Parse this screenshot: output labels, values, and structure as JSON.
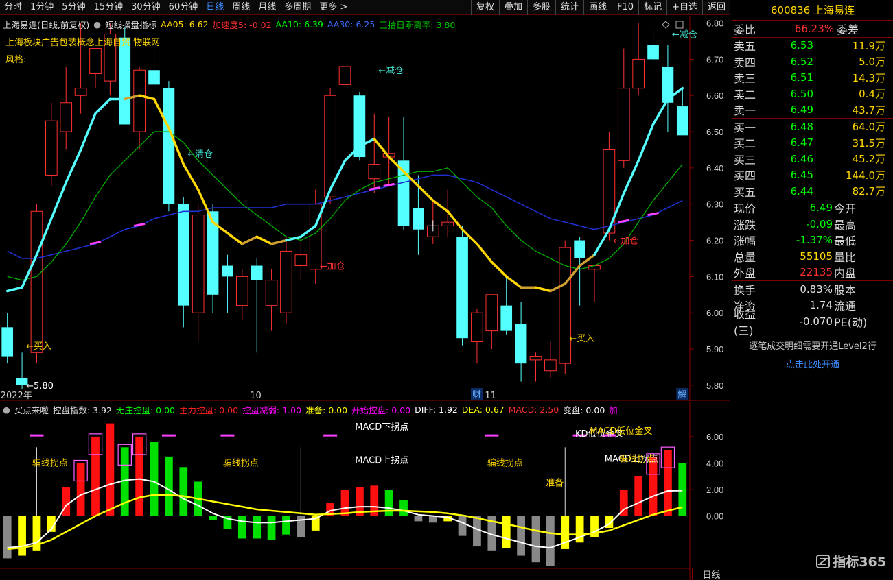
{
  "toolbar": {
    "periods": [
      "分时",
      "1分钟",
      "5分钟",
      "15分钟",
      "30分钟",
      "60分钟",
      "日线",
      "周线",
      "月线",
      "多周期",
      "更多 >"
    ],
    "active": "日线",
    "buttons": [
      "复权",
      "叠加",
      "多股",
      "统计",
      "画线",
      "F10",
      "标记",
      "+自选",
      "返回"
    ]
  },
  "main_indicator": {
    "stock_title": "上海易连(日线,前复权)",
    "name": "短线操盘指标",
    "items": [
      {
        "label": "AA05:",
        "value": "6.62",
        "color": "#ffd700"
      },
      {
        "label": "加速度5:",
        "value": "-0.02",
        "color": "#ff3030"
      },
      {
        "label": "AA10:",
        "value": "6.39",
        "color": "#00ff00"
      },
      {
        "label": "AA30:",
        "value": "6.25",
        "color": "#3d6bff"
      },
      {
        "label": "三拾日乖离率:",
        "value": "3.80",
        "color": "#00c800"
      }
    ],
    "sector_line": "上海板块广告包装概念上海自贸 物联网",
    "style_line": "风格:"
  },
  "sub_indicator": {
    "name": "买点来啦",
    "items": [
      {
        "label": "控盘指数:",
        "value": "3.92",
        "color": "#e0e0e0"
      },
      {
        "label": "无庄控盘:",
        "value": "0.00",
        "color": "#00ff00"
      },
      {
        "label": "主力控盘:",
        "value": "0.00",
        "color": "#ff2020"
      },
      {
        "label": "控盘减弱:",
        "value": "1.00",
        "color": "#ff00ff"
      },
      {
        "label": "准备:",
        "value": "0.00",
        "color": "#ffff00"
      },
      {
        "label": "开始控盘:",
        "value": "0.00",
        "color": "#ff00ff"
      },
      {
        "label": "DIFF:",
        "value": "1.92",
        "color": "#ffffff"
      },
      {
        "label": "DEA:",
        "value": "0.67",
        "color": "#ffff00"
      },
      {
        "label": "MACD:",
        "value": "2.50",
        "color": "#ff3030"
      },
      {
        "label": "变盘:",
        "value": "0.00",
        "color": "#ffffff"
      },
      {
        "label": "加",
        "value": "",
        "color": "#ff00ff"
      }
    ]
  },
  "chart_data": {
    "type": "candlestick",
    "ylim": [
      5.76,
      6.82
    ],
    "y_ticks": [
      "6.80",
      "6.70",
      "6.60",
      "6.50",
      "6.40",
      "6.30",
      "6.20",
      "6.10",
      "6.00",
      "5.90",
      "5.80"
    ],
    "x_labels": [
      {
        "i": 0,
        "text": "2022年"
      },
      {
        "i": 17,
        "text": "10"
      },
      {
        "i": 33,
        "text": "11"
      }
    ],
    "markers": [
      {
        "i": 32,
        "text": "财"
      },
      {
        "i": 46,
        "text": "解"
      }
    ],
    "candles": [
      {
        "o": 5.96,
        "h": 6.0,
        "l": 5.86,
        "c": 5.88
      },
      {
        "o": 5.82,
        "h": 5.89,
        "l": 5.79,
        "c": 5.8
      },
      {
        "o": 5.89,
        "h": 6.3,
        "l": 5.86,
        "c": 6.28
      },
      {
        "o": 6.38,
        "h": 6.58,
        "l": 6.35,
        "c": 6.53
      },
      {
        "o": 6.5,
        "h": 6.68,
        "l": 6.45,
        "c": 6.58
      },
      {
        "o": 6.6,
        "h": 6.8,
        "l": 6.55,
        "c": 6.62
      },
      {
        "o": 6.66,
        "h": 6.72,
        "l": 6.62,
        "c": 6.73
      },
      {
        "o": 6.64,
        "h": 6.8,
        "l": 6.6,
        "c": 6.77
      },
      {
        "o": 6.76,
        "h": 6.79,
        "l": 6.6,
        "c": 6.52
      },
      {
        "o": 6.5,
        "h": 6.68,
        "l": 6.45,
        "c": 6.67
      },
      {
        "o": 6.67,
        "h": 6.74,
        "l": 6.58,
        "c": 6.63
      },
      {
        "o": 6.62,
        "h": 6.64,
        "l": 6.28,
        "c": 6.3
      },
      {
        "o": 6.3,
        "h": 6.32,
        "l": 5.96,
        "c": 6.02
      },
      {
        "o": 6.0,
        "h": 6.3,
        "l": 5.92,
        "c": 6.27
      },
      {
        "o": 6.28,
        "h": 6.3,
        "l": 6.0,
        "c": 6.05
      },
      {
        "o": 6.13,
        "h": 6.16,
        "l": 6.0,
        "c": 6.1
      },
      {
        "o": 6.02,
        "h": 6.12,
        "l": 5.98,
        "c": 6.1
      },
      {
        "o": 6.13,
        "h": 6.15,
        "l": 5.89,
        "c": 6.09
      },
      {
        "o": 6.02,
        "h": 6.12,
        "l": 5.95,
        "c": 6.09
      },
      {
        "o": 6.0,
        "h": 6.21,
        "l": 5.97,
        "c": 6.17
      },
      {
        "o": 6.13,
        "h": 6.2,
        "l": 6.09,
        "c": 6.16
      },
      {
        "o": 6.12,
        "h": 6.34,
        "l": 6.08,
        "c": 6.3
      },
      {
        "o": 6.32,
        "h": 6.62,
        "l": 6.3,
        "c": 6.6
      },
      {
        "o": 6.63,
        "h": 6.72,
        "l": 6.55,
        "c": 6.68
      },
      {
        "o": 6.6,
        "h": 6.61,
        "l": 6.42,
        "c": 6.43
      },
      {
        "o": 6.37,
        "h": 6.55,
        "l": 6.33,
        "c": 6.41
      },
      {
        "o": 6.43,
        "h": 6.54,
        "l": 6.35,
        "c": 6.44
      },
      {
        "o": 6.42,
        "h": 6.54,
        "l": 6.23,
        "c": 6.24
      },
      {
        "o": 6.29,
        "h": 6.38,
        "l": 6.16,
        "c": 6.23
      },
      {
        "o": 6.21,
        "h": 6.31,
        "l": 6.19,
        "c": 6.24
      },
      {
        "o": 6.24,
        "h": 6.34,
        "l": 6.21,
        "c": 6.25
      },
      {
        "o": 6.21,
        "h": 6.24,
        "l": 5.91,
        "c": 5.93
      },
      {
        "o": 5.92,
        "h": 6.01,
        "l": 5.86,
        "c": 6.0
      },
      {
        "o": 5.95,
        "h": 6.05,
        "l": 5.9,
        "c": 6.05
      },
      {
        "o": 6.02,
        "h": 6.1,
        "l": 5.94,
        "c": 5.95
      },
      {
        "o": 5.97,
        "h": 6.03,
        "l": 5.81,
        "c": 5.86
      },
      {
        "o": 5.87,
        "h": 5.89,
        "l": 5.81,
        "c": 5.88
      },
      {
        "o": 5.84,
        "h": 5.92,
        "l": 5.82,
        "c": 5.87
      },
      {
        "o": 5.86,
        "h": 6.2,
        "l": 5.83,
        "c": 6.18
      },
      {
        "o": 6.2,
        "h": 6.21,
        "l": 6.02,
        "c": 6.15
      },
      {
        "o": 6.12,
        "h": 6.12,
        "l": 6.03,
        "c": 6.13
      },
      {
        "o": 6.22,
        "h": 6.5,
        "l": 6.2,
        "c": 6.45
      },
      {
        "o": 6.42,
        "h": 6.73,
        "l": 6.4,
        "c": 6.62
      },
      {
        "o": 6.62,
        "h": 6.8,
        "l": 6.6,
        "c": 6.7
      },
      {
        "o": 6.74,
        "h": 6.78,
        "l": 6.68,
        "c": 6.7
      },
      {
        "o": 6.68,
        "h": 6.74,
        "l": 6.5,
        "c": 6.58
      },
      {
        "o": 6.57,
        "h": 6.62,
        "l": 6.49,
        "c": 6.49
      }
    ],
    "aa05": [
      6.06,
      6.07,
      6.16,
      6.26,
      6.36,
      6.45,
      6.55,
      6.59,
      6.59,
      6.6,
      6.59,
      6.51,
      6.41,
      6.34,
      6.25,
      6.22,
      6.19,
      6.21,
      6.19,
      6.2,
      6.21,
      6.24,
      6.34,
      6.42,
      6.46,
      6.48,
      6.43,
      6.39,
      6.35,
      6.31,
      6.28,
      6.23,
      6.19,
      6.14,
      6.1,
      6.07,
      6.07,
      6.06,
      6.08,
      6.13,
      6.16,
      6.23,
      6.33,
      6.42,
      6.52,
      6.59,
      6.62
    ],
    "aa10": [
      6.1,
      6.09,
      6.1,
      6.14,
      6.19,
      6.25,
      6.32,
      6.38,
      6.42,
      6.46,
      6.5,
      6.5,
      6.47,
      6.42,
      6.38,
      6.34,
      6.3,
      6.27,
      6.24,
      6.21,
      6.2,
      6.22,
      6.26,
      6.31,
      6.34,
      6.36,
      6.37,
      6.38,
      6.39,
      6.39,
      6.4,
      6.36,
      6.32,
      6.29,
      6.24,
      6.2,
      6.17,
      6.15,
      6.13,
      6.12,
      6.13,
      6.15,
      6.19,
      6.25,
      6.31,
      6.36,
      6.41
    ],
    "aa30": [
      6.17,
      6.15,
      6.15,
      6.16,
      6.17,
      6.18,
      6.19,
      6.21,
      6.23,
      6.24,
      6.26,
      6.27,
      6.28,
      6.28,
      6.29,
      6.29,
      6.29,
      6.29,
      6.29,
      6.3,
      6.3,
      6.3,
      6.31,
      6.32,
      6.33,
      6.34,
      6.35,
      6.36,
      6.37,
      6.38,
      6.38,
      6.37,
      6.36,
      6.34,
      6.32,
      6.3,
      6.28,
      6.26,
      6.25,
      6.24,
      6.23,
      6.24,
      6.25,
      6.26,
      6.27,
      6.29,
      6.31
    ],
    "annotations": [
      {
        "i": 1,
        "p": 5.8,
        "text": "←5.80",
        "color": "#ffffff"
      },
      {
        "i": 1,
        "p": 5.91,
        "text": "←买入",
        "color": "#ffd700"
      },
      {
        "i": 8,
        "p": 6.83,
        "text": "减仓",
        "color": "#40e0d0"
      },
      {
        "i": 12,
        "p": 6.44,
        "text": "←清仓",
        "color": "#40e0d0"
      },
      {
        "i": 21,
        "p": 6.13,
        "text": "←加仓",
        "color": "#ff3030"
      },
      {
        "i": 25,
        "p": 6.67,
        "text": "←减仓",
        "color": "#40e0d0"
      },
      {
        "i": 38,
        "p": 5.93,
        "text": "←买入",
        "color": "#ffd700"
      },
      {
        "i": 41,
        "p": 6.2,
        "text": "←加仓",
        "color": "#ff3030"
      },
      {
        "i": 45,
        "p": 6.77,
        "text": "←减仓",
        "color": "#40e0d0"
      }
    ],
    "sub_ylim": [
      -3.8,
      7.6
    ],
    "sub_ticks": [
      "6.00",
      "4.00",
      "2.00",
      "0.00"
    ],
    "macd": [
      -3.2,
      -3.0,
      -2.6,
      -1.2,
      2.2,
      4.0,
      6.0,
      7.0,
      5.2,
      6.0,
      5.6,
      4.5,
      3.7,
      2.6,
      -0.3,
      -1.0,
      -1.7,
      -1.7,
      -1.8,
      -1.4,
      -1.6,
      -1.1,
      1.0,
      2.0,
      2.2,
      2.3,
      2.0,
      1.2,
      -0.4,
      -0.5,
      -0.4,
      -1.5,
      -2.3,
      -2.6,
      -2.4,
      -3.0,
      -3.5,
      -3.8,
      -2.5,
      -2.0,
      -1.6,
      -0.9,
      2.0,
      3.0,
      4.5,
      5.0,
      4.0
    ],
    "diff": [
      -2.4,
      -2.3,
      -2.0,
      -1.0,
      0.8,
      1.6,
      2.0,
      2.4,
      2.7,
      2.8,
      2.6,
      2.0,
      1.3,
      0.8,
      0.2,
      -0.2,
      -0.4,
      -0.5,
      -0.5,
      -0.4,
      -0.3,
      -0.2,
      0.4,
      0.6,
      0.7,
      0.7,
      0.6,
      0.4,
      0.1,
      0.0,
      -0.1,
      -0.5,
      -1.0,
      -1.4,
      -1.7,
      -2.0,
      -2.3,
      -2.4,
      -2.0,
      -1.6,
      -1.2,
      -0.6,
      0.5,
      1.0,
      1.5,
      1.9,
      1.92
    ],
    "dea": [
      -2.5,
      -2.4,
      -2.2,
      -1.8,
      -1.2,
      -0.6,
      0.0,
      0.5,
      1.0,
      1.4,
      1.6,
      1.6,
      1.5,
      1.3,
      1.1,
      0.9,
      0.7,
      0.5,
      0.4,
      0.3,
      0.2,
      0.1,
      0.15,
      0.2,
      0.3,
      0.35,
      0.4,
      0.4,
      0.35,
      0.3,
      0.2,
      0.05,
      -0.15,
      -0.4,
      -0.6,
      -0.85,
      -1.1,
      -1.3,
      -1.4,
      -1.4,
      -1.3,
      -1.1,
      -0.7,
      -0.3,
      0.1,
      0.4,
      0.67
    ],
    "sub_annotations": [
      {
        "i": 3,
        "v": 3.8,
        "text": "骗线拐点",
        "color": "#ffd700"
      },
      {
        "i": 16,
        "v": 3.8,
        "text": "骗线拐点",
        "color": "#ffd700"
      },
      {
        "i": 25,
        "v": 6.5,
        "text": "MACD下拐点",
        "color": "#ffffff"
      },
      {
        "i": 25,
        "v": 4.0,
        "text": "MACD上拐点",
        "color": "#ffffff"
      },
      {
        "i": 34,
        "v": 3.8,
        "text": "骗线拐点",
        "color": "#ffd700"
      },
      {
        "i": 38,
        "v": 2.3,
        "text": "准备",
        "color": "#ffd700"
      },
      {
        "i": 40,
        "v": 6.0,
        "text": "KD低位金叉",
        "color": "#ffffff"
      },
      {
        "i": 41,
        "v": 6.2,
        "text": "MACD低位金叉",
        "color": "#ffd700"
      },
      {
        "i": 42,
        "v": 4.1,
        "text": "MACD上拐点",
        "color": "#ffffff"
      },
      {
        "i": 43,
        "v": 4.1,
        "text": "骗线拐点",
        "color": "#ffd700"
      }
    ]
  },
  "quote": {
    "code_name": "600836 上海易连",
    "weibi_label": "委比",
    "weibi_value": "66.23%",
    "weicha_label": "委差",
    "asks": [
      {
        "label": "卖五",
        "price": "6.53",
        "vol": "11.9万"
      },
      {
        "label": "卖四",
        "price": "6.52",
        "vol": "5.0万"
      },
      {
        "label": "卖三",
        "price": "6.51",
        "vol": "14.3万"
      },
      {
        "label": "卖二",
        "price": "6.50",
        "vol": "0.4万"
      },
      {
        "label": "卖一",
        "price": "6.49",
        "vol": "43.7万"
      }
    ],
    "bids": [
      {
        "label": "买一",
        "price": "6.48",
        "vol": "64.0万"
      },
      {
        "label": "买二",
        "price": "6.47",
        "vol": "31.5万"
      },
      {
        "label": "买三",
        "price": "6.46",
        "vol": "45.2万"
      },
      {
        "label": "买四",
        "price": "6.45",
        "vol": "144.0万"
      },
      {
        "label": "买五",
        "price": "6.44",
        "vol": "82.7万"
      }
    ],
    "stats1": [
      {
        "l": "现价",
        "v": "6.49",
        "c": "#00ff00",
        "r": "今开"
      },
      {
        "l": "涨跌",
        "v": "-0.09",
        "c": "#00ff00",
        "r": "最高"
      },
      {
        "l": "涨幅",
        "v": "-1.37%",
        "c": "#00ff00",
        "r": "最低"
      },
      {
        "l": "总量",
        "v": "55105",
        "c": "#ffd700",
        "r": "量比"
      },
      {
        "l": "外盘",
        "v": "22135",
        "c": "#ff3030",
        "r": "内盘"
      }
    ],
    "stats2": [
      {
        "l": "换手",
        "v": "0.83%",
        "c": "#e0e0e0",
        "r": "股本"
      },
      {
        "l": "净资",
        "v": "1.74",
        "c": "#e0e0e0",
        "r": "流通"
      },
      {
        "l": "收益(三)",
        "v": "-0.070",
        "c": "#e0e0e0",
        "r": "PE(动)"
      }
    ],
    "level2_note": "逐笔成交明细需要开通Level2行",
    "open_link": "点击此处开通"
  },
  "bottom_tab": "日线",
  "watermark": "指标365"
}
